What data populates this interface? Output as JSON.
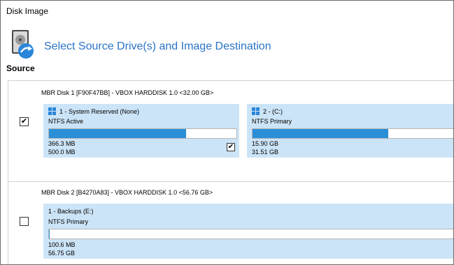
{
  "window": {
    "title": "Disk Image"
  },
  "header": {
    "title": "Select Source Drive(s) and Image Destination",
    "icon": "disk-image-icon",
    "accent_color": "#2a74c8"
  },
  "source": {
    "label": "Source"
  },
  "disks": [
    {
      "header": "MBR Disk 1 [F90F47BB] - VBOX HARDDISK 1.0  <32.00 GB>",
      "selected": true,
      "check_glyph": "✔",
      "partitions": [
        {
          "title": "1 - System Reserved (None)",
          "fs": "NTFS Active",
          "used": "366.3 MB",
          "total": "500.0 MB",
          "fill_fraction": 0.73,
          "selected": true,
          "check_glyph": "✔"
        },
        {
          "title": "2 - (C:)",
          "fs": "NTFS Primary",
          "used": "15.90 GB",
          "total": "31.51 GB",
          "fill_fraction": 0.51
        }
      ]
    },
    {
      "header": "MBR Disk 2 [B4270A83] - VBOX HARDDISK 1.0  <56.76 GB>",
      "selected": false,
      "check_glyph": "",
      "partitions": [
        {
          "title": "1 - Backups (E:)",
          "fs": "NTFS Primary",
          "used": "100.6 MB",
          "total": "56.75 GB",
          "fill_fraction": 0.002
        }
      ]
    }
  ],
  "colors": {
    "partition_bg": "#cce4f7",
    "bar_fill": "#2b8fd8"
  }
}
